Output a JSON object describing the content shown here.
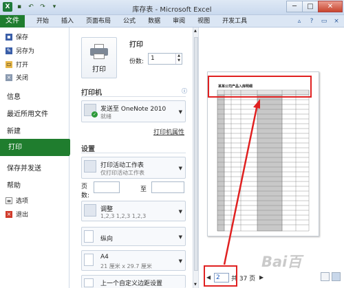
{
  "window": {
    "title": "库存表 - Microsoft Excel",
    "app_icon": "X",
    "controls": [
      "─",
      "□",
      "✕"
    ]
  },
  "menu": {
    "file": "文件",
    "tabs": [
      "开始",
      "插入",
      "页面布局",
      "公式",
      "数据",
      "审阅",
      "视图",
      "开发工具"
    ]
  },
  "nav": {
    "save": "保存",
    "save_as": "另存为",
    "open": "打开",
    "close": "关闭",
    "info": "信息",
    "recent": "最近所用文件",
    "new": "新建",
    "print": "打印",
    "save_send": "保存并发送",
    "help": "帮助",
    "options": "选项",
    "exit": "退出"
  },
  "print": {
    "button_label": "打印",
    "header": "打印",
    "copies_label": "份数:",
    "copies_value": "1"
  },
  "printer": {
    "section": "打印机",
    "name": "发送至 OneNote 2010",
    "status": "就绪",
    "properties_link": "打印机属性"
  },
  "settings": {
    "section": "设置",
    "what": "打印活动工作表",
    "what_sub": "仅打印活动工作表",
    "pages_label": "页数:",
    "to_label": "至",
    "collate": "调整",
    "collate_sub": "1,2,3    1,2,3    1,2,3",
    "orientation": "纵向",
    "paper": "A4",
    "paper_sub": "21 厘米 x 29.7 厘米",
    "margins": "上一个自定义边距设置"
  },
  "preview": {
    "page_title": "某某公司产品入库明细",
    "current_page": "2",
    "total_pages": "共 37 页"
  }
}
